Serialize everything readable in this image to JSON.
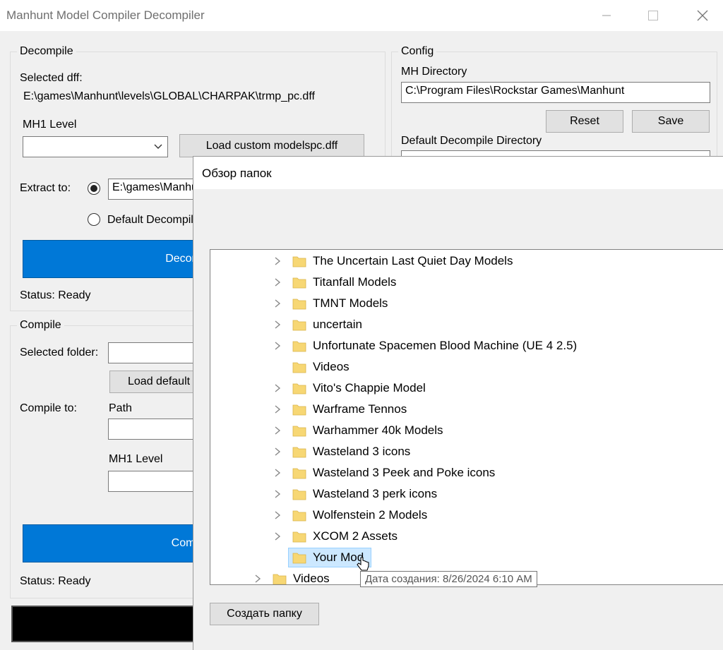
{
  "window": {
    "title": "Manhunt Model Compiler Decompiler",
    "minimize_icon": "minimize-icon",
    "maximize_icon": "maximize-icon",
    "close_icon": "close-icon"
  },
  "decompile": {
    "group_label": "Decompile",
    "selected_dff_label": "Selected dff:",
    "selected_dff_path": "E:\\games\\Manhunt\\levels\\GLOBAL\\CHARPAK\\trmp_pc.dff",
    "level_label": "MH1 Level",
    "level_value": "",
    "load_custom_button": "Load custom modelspc.dff",
    "extract_label": "Extract to:",
    "extract_path": "E:\\games\\Manhunt",
    "default_option": "Default Decompile Directory",
    "decompile_button": "Decompile",
    "status": "Status: Ready"
  },
  "compile": {
    "group_label": "Compile",
    "selected_folder_label": "Selected folder:",
    "selected_folder_value": "",
    "load_default_button": "Load default",
    "compile_to_label": "Compile to:",
    "path_label": "Path",
    "path_value": "",
    "level_label": "MH1 Level",
    "level_value": "",
    "compile_button": "Compile",
    "status": "Status: Ready"
  },
  "config": {
    "group_label": "Config",
    "mh_dir_label": "MH Directory",
    "mh_dir_value": "C:\\Program Files\\Rockstar Games\\Manhunt",
    "reset_button": "Reset",
    "save_button": "Save",
    "default_dir_label": "Default Decompile Directory"
  },
  "browse_dialog": {
    "title": "Обзор папок",
    "items": [
      {
        "label": "The Uncertain Last Quiet Day Models",
        "expandable": true
      },
      {
        "label": "Titanfall Models",
        "expandable": true
      },
      {
        "label": "TMNT Models",
        "expandable": true
      },
      {
        "label": "uncertain",
        "expandable": true
      },
      {
        "label": "Unfortunate Spacemen Blood Machine (UE 4 2.5)",
        "expandable": true
      },
      {
        "label": "Videos",
        "expandable": false
      },
      {
        "label": "Vito's Chappie Model",
        "expandable": true
      },
      {
        "label": "Warframe Tennos",
        "expandable": true
      },
      {
        "label": "Warhammer 40k Models",
        "expandable": true
      },
      {
        "label": "Wasteland 3 icons",
        "expandable": true
      },
      {
        "label": "Wasteland 3 Peek and Poke icons",
        "expandable": true
      },
      {
        "label": "Wasteland 3 perk icons",
        "expandable": true
      },
      {
        "label": "Wolfenstein 2 Models",
        "expandable": true
      },
      {
        "label": "XCOM 2 Assets",
        "expandable": true
      },
      {
        "label": "Your Mod",
        "expandable": false,
        "selected": true
      }
    ],
    "parent_item": {
      "label": "Videos",
      "expandable": true
    },
    "tooltip": "Дата создания: 8/26/2024 6:10 AM",
    "new_folder_button": "Создать папку"
  },
  "colors": {
    "accent": "#0078d7",
    "selection": "#cce8ff",
    "folder": "#f7d774"
  }
}
